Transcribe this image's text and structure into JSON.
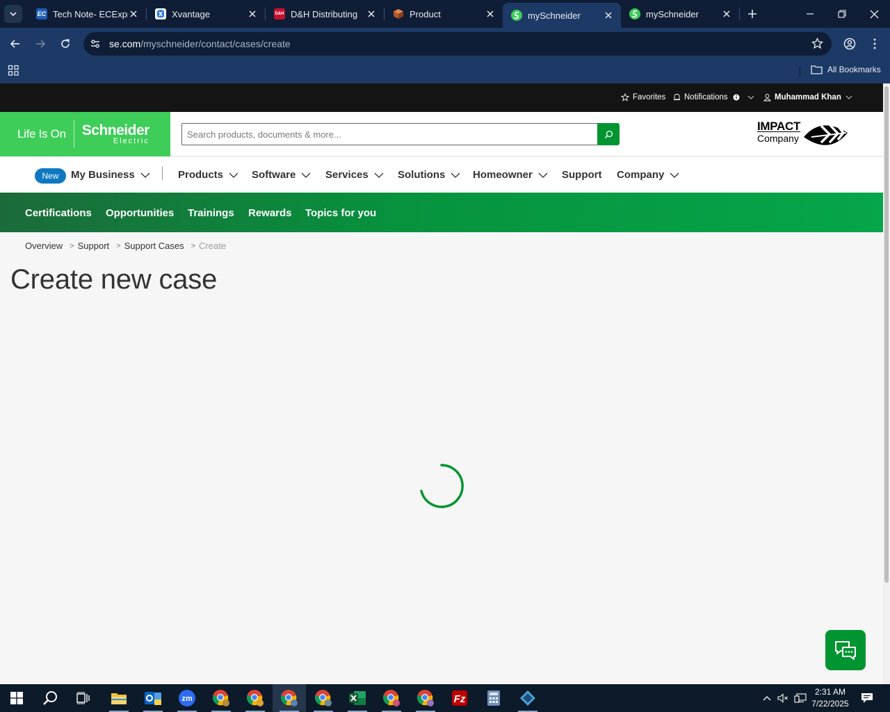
{
  "browser": {
    "tabs": [
      {
        "title": "Tech Note- ECExpr",
        "favicon_text": "EC",
        "favicon_color": "#1f5fb5"
      },
      {
        "title": "Xvantage",
        "favicon_text": "",
        "favicon_color": "#2a7de1"
      },
      {
        "title": "D&H Distributing",
        "favicon_text": "D&H",
        "favicon_color": "#c8102e"
      },
      {
        "title": "Product",
        "favicon_text": "",
        "favicon_color": "#c06a3a"
      },
      {
        "title": "mySchneider",
        "favicon_text": "",
        "favicon_color": "#3dcd58"
      },
      {
        "title": "mySchneider",
        "favicon_text": "",
        "favicon_color": "#3dcd58"
      }
    ],
    "active_tab_index": 4,
    "url_host": "se.com",
    "url_path": "/myschneider/contact/cases/create",
    "bookmarks_label": "All Bookmarks"
  },
  "utility": {
    "favorites": "Favorites",
    "notifications": "Notifications",
    "user": "Muhammad Khan"
  },
  "header": {
    "tagline": "Life Is On",
    "brand_name": "Schneider",
    "brand_sub": "Electric",
    "search_placeholder": "Search products, documents & more...",
    "impact_line1": "IMPACT",
    "impact_line2": "Company"
  },
  "nav": {
    "new_badge": "New",
    "items": [
      "My Business",
      "Products",
      "Software",
      "Services",
      "Solutions",
      "Homeowner",
      "Support",
      "Company"
    ]
  },
  "subnav": {
    "items": [
      "Certifications",
      "Opportunities",
      "Trainings",
      "Rewards",
      "Topics for you"
    ]
  },
  "breadcrumb": {
    "items": [
      "Overview",
      "Support",
      "Support Cases"
    ],
    "current": "Create"
  },
  "page": {
    "title": "Create new case"
  },
  "taskbar": {
    "time": "2:31 AM",
    "date": "7/22/2025"
  },
  "colors": {
    "brand_green": "#3dcd58",
    "dark_green": "#009530",
    "new_badge_blue": "#0e79c1"
  }
}
